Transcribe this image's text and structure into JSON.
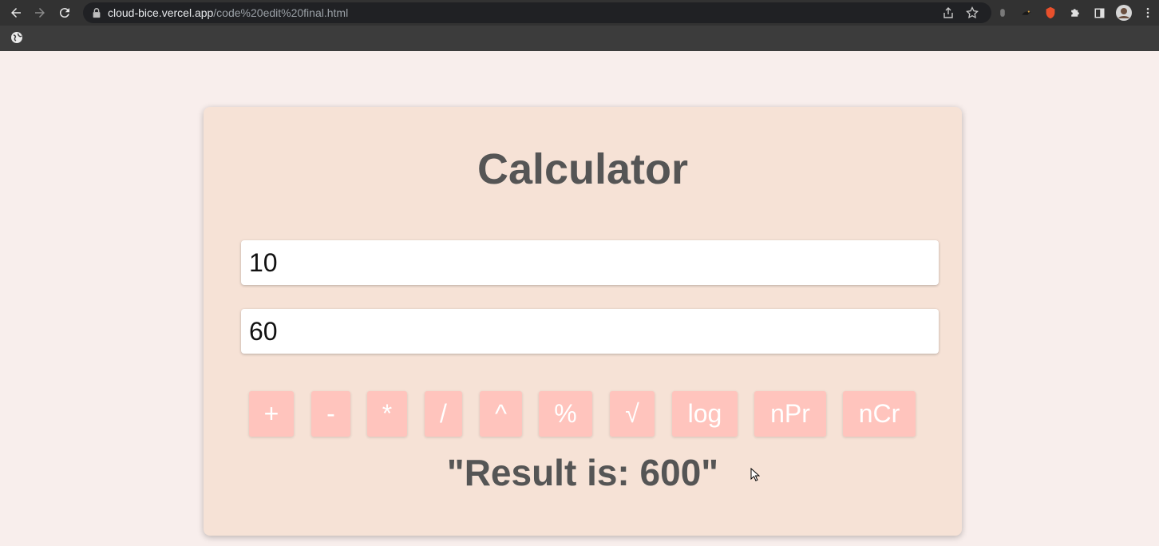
{
  "browser": {
    "url_host": "cloud-bice.vercel.app",
    "url_path": "/code%20edit%20final.html",
    "icons": {
      "back": "back-arrow-icon",
      "forward": "forward-arrow-icon",
      "reload": "reload-icon",
      "lock": "lock-icon",
      "share": "share-icon",
      "bookmark": "star-icon",
      "extensions": "puzzle-icon",
      "sidebar": "side-panel-icon",
      "profile": "avatar",
      "menu": "kebab-menu-icon",
      "bookmark_bar_item": "globe-icon"
    }
  },
  "calculator": {
    "title": "Calculator",
    "input1_value": "10",
    "input2_value": "60",
    "operations": [
      "+",
      "-",
      "*",
      "/",
      "^",
      "%",
      "√",
      "log",
      "nPr",
      "nCr"
    ],
    "result_text": "\"Result is: 600\""
  },
  "colors": {
    "page_background": "#f8eeec",
    "card_background": "#f6e2d6",
    "button_background": "#ffc4bd",
    "text_color": "#555555"
  }
}
